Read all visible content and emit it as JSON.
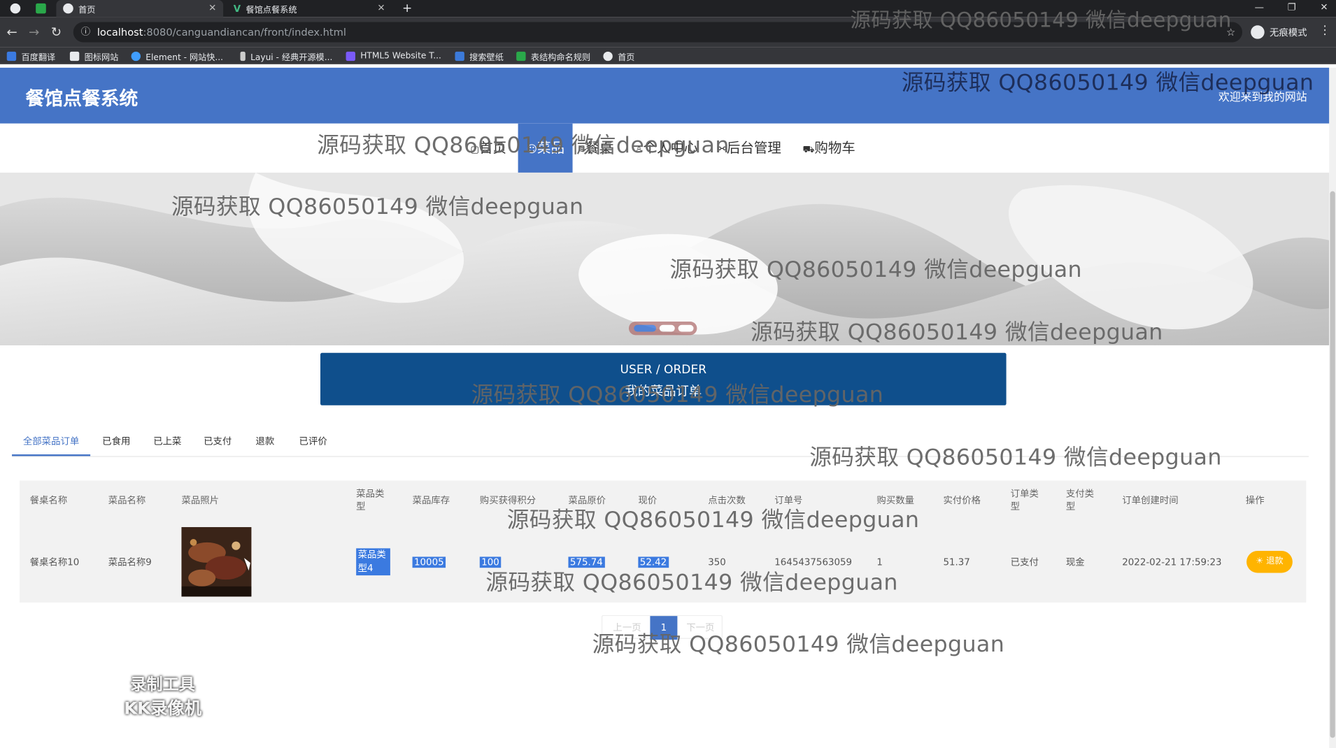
{
  "browser": {
    "tabs": [
      {
        "label": "首页",
        "active": true
      },
      {
        "label": "餐馆点餐系统",
        "active": false
      }
    ],
    "new_tab": "+",
    "url_host": "localhost",
    "url_path": ":8080/canguandiancan/front/index.html",
    "profile_label": "无痕模式",
    "bookmarks": [
      "百度翻译",
      "图标网站",
      "Element - 网站快...",
      "Layui - 经典开源模...",
      "HTML5 Website T...",
      "搜索壁纸",
      "表结构命名规则",
      "首页"
    ]
  },
  "header": {
    "site_title": "餐馆点餐系统",
    "welcome": "欢迎来到我的网站"
  },
  "nav": {
    "items": [
      "首页",
      "菜品",
      "餐桌",
      "个人中心",
      "后台管理",
      "购物车"
    ],
    "active_index": 1
  },
  "carousel": {
    "slide_count": 3,
    "active_index": 0
  },
  "section": {
    "title_en": "USER / ORDER",
    "title_cn": "我的菜品订单"
  },
  "order_tabs": {
    "items": [
      "全部菜品订单",
      "已食用",
      "已上菜",
      "已支付",
      "退款",
      "已评价"
    ],
    "active_index": 0
  },
  "table": {
    "columns": [
      "餐桌名称",
      "菜品名称",
      "菜品照片",
      "菜品类型",
      "菜品库存",
      "购买获得积分",
      "菜品原价",
      "现价",
      "点击次数",
      "订单号",
      "购买数量",
      "实付价格",
      "订单类型",
      "支付类型",
      "订单创建时间",
      "操作"
    ],
    "rows": [
      {
        "table_name": "餐桌名称10",
        "dish_name": "菜品名称9",
        "photo": "grilled-meat-photo",
        "dish_type": "菜品类型4",
        "stock": "10005",
        "points": "100",
        "original_price": "575.74",
        "current_price": "52.42",
        "clicks": "350",
        "order_no": "1645437563059",
        "quantity": "1",
        "paid": "51.37",
        "order_type": "已支付",
        "pay_type": "现金",
        "created": "2022-02-21 17:59:23",
        "action": "退款"
      }
    ]
  },
  "pagination": {
    "prev": "上一页",
    "current": "1",
    "next": "下一页"
  },
  "overlays": {
    "watermark": "源码获取 QQ86050149 微信deepguan",
    "recorder_line1": "录制工具",
    "recorder_line2": "KK录像机"
  },
  "colors": {
    "primary": "#4574c6",
    "title_bar": "#0f4f8c",
    "refund": "#ffb400"
  }
}
